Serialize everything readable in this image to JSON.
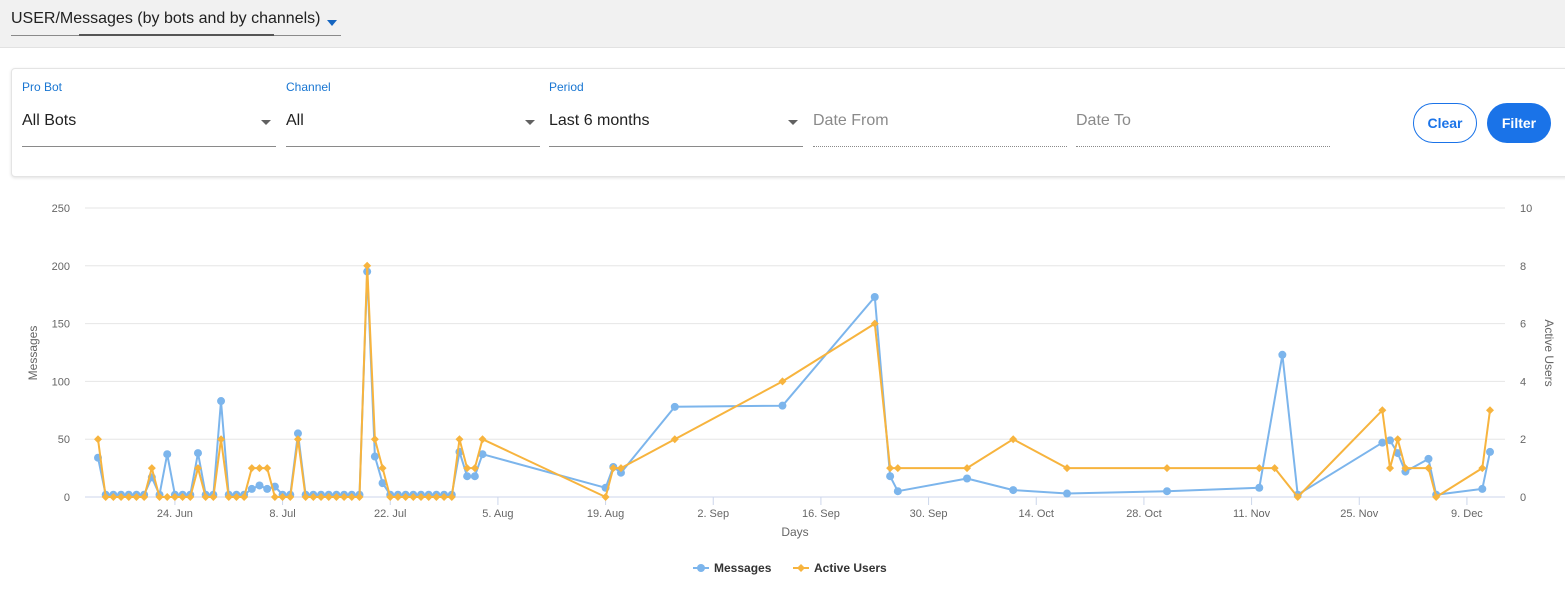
{
  "report_selector": {
    "label": "USER/Messages (by bots and by channels)"
  },
  "filters": {
    "bot": {
      "label": "Pro Bot",
      "value": "All Bots"
    },
    "channel": {
      "label": "Channel",
      "value": "All"
    },
    "period": {
      "label": "Period",
      "value": "Last 6 months"
    },
    "date_from": {
      "placeholder": "Date From"
    },
    "date_to": {
      "placeholder": "Date To"
    },
    "clear_label": "Clear",
    "filter_label": "Filter"
  },
  "colors": {
    "accent": "#1a73e8",
    "messages": "#7cb5ec",
    "active_users": "#f7b43e"
  },
  "chart_data": {
    "type": "line",
    "xlabel": "Days",
    "x_ticks": [
      "24. Jun",
      "8. Jul",
      "22. Jul",
      "5. Aug",
      "19. Aug",
      "2. Sep",
      "16. Sep",
      "30. Sep",
      "14. Oct",
      "28. Oct",
      "11. Nov",
      "25. Nov",
      "9. Dec"
    ],
    "x_tick_days": [
      10,
      24,
      38,
      52,
      66,
      80,
      94,
      108,
      122,
      136,
      150,
      164,
      178
    ],
    "y_left": {
      "label": "Messages",
      "min": 0,
      "max": 250,
      "ticks": [
        0,
        50,
        100,
        150,
        200,
        250
      ]
    },
    "y_right": {
      "label": "Active Users",
      "min": 0,
      "max": 10,
      "ticks": [
        0,
        2,
        4,
        6,
        8,
        10
      ]
    },
    "grid": true,
    "legend": "bottom-center",
    "series": [
      {
        "name": "Messages",
        "axis": "left",
        "marker": "circle",
        "points": [
          [
            0,
            34
          ],
          [
            1,
            2
          ],
          [
            2,
            2
          ],
          [
            3,
            2
          ],
          [
            4,
            2
          ],
          [
            5,
            2
          ],
          [
            6,
            2
          ],
          [
            7,
            17
          ],
          [
            8,
            2
          ],
          [
            9,
            37
          ],
          [
            10,
            2
          ],
          [
            11,
            2
          ],
          [
            12,
            2
          ],
          [
            13,
            38
          ],
          [
            14,
            2
          ],
          [
            15,
            2
          ],
          [
            16,
            83
          ],
          [
            17,
            2
          ],
          [
            18,
            2
          ],
          [
            19,
            2
          ],
          [
            20,
            7
          ],
          [
            21,
            10
          ],
          [
            22,
            7
          ],
          [
            23,
            9
          ],
          [
            24,
            2
          ],
          [
            25,
            2
          ],
          [
            26,
            55
          ],
          [
            27,
            2
          ],
          [
            28,
            2
          ],
          [
            29,
            2
          ],
          [
            30,
            2
          ],
          [
            31,
            2
          ],
          [
            32,
            2
          ],
          [
            33,
            2
          ],
          [
            34,
            2
          ],
          [
            35,
            195
          ],
          [
            36,
            35
          ],
          [
            37,
            12
          ],
          [
            38,
            2
          ],
          [
            39,
            2
          ],
          [
            40,
            2
          ],
          [
            41,
            2
          ],
          [
            42,
            2
          ],
          [
            43,
            2
          ],
          [
            44,
            2
          ],
          [
            45,
            2
          ],
          [
            46,
            2
          ],
          [
            47,
            39
          ],
          [
            48,
            18
          ],
          [
            49,
            18
          ],
          [
            50,
            37
          ],
          [
            66,
            8
          ],
          [
            67,
            26
          ],
          [
            68,
            21
          ],
          [
            75,
            78
          ],
          [
            89,
            79
          ],
          [
            101,
            173
          ],
          [
            103,
            18
          ],
          [
            104,
            5
          ],
          [
            113,
            16
          ],
          [
            119,
            6
          ],
          [
            126,
            3
          ],
          [
            139,
            5
          ],
          [
            151,
            8
          ],
          [
            154,
            123
          ],
          [
            156,
            2
          ],
          [
            167,
            47
          ],
          [
            168,
            49
          ],
          [
            169,
            38
          ],
          [
            170,
            22
          ],
          [
            173,
            33
          ],
          [
            174,
            2
          ],
          [
            180,
            7
          ],
          [
            181,
            39
          ]
        ]
      },
      {
        "name": "Active Users",
        "axis": "right",
        "marker": "diamond",
        "points": [
          [
            0,
            2
          ],
          [
            1,
            0
          ],
          [
            2,
            0
          ],
          [
            3,
            0
          ],
          [
            4,
            0
          ],
          [
            5,
            0
          ],
          [
            6,
            0
          ],
          [
            7,
            1
          ],
          [
            8,
            0
          ],
          [
            9,
            0
          ],
          [
            10,
            0
          ],
          [
            11,
            0
          ],
          [
            12,
            0
          ],
          [
            13,
            1
          ],
          [
            14,
            0
          ],
          [
            15,
            0
          ],
          [
            16,
            2
          ],
          [
            17,
            0
          ],
          [
            18,
            0
          ],
          [
            19,
            0
          ],
          [
            20,
            1
          ],
          [
            21,
            1
          ],
          [
            22,
            1
          ],
          [
            23,
            0
          ],
          [
            24,
            0
          ],
          [
            25,
            0
          ],
          [
            26,
            2
          ],
          [
            27,
            0
          ],
          [
            28,
            0
          ],
          [
            29,
            0
          ],
          [
            30,
            0
          ],
          [
            31,
            0
          ],
          [
            32,
            0
          ],
          [
            33,
            0
          ],
          [
            34,
            0
          ],
          [
            35,
            8
          ],
          [
            36,
            2
          ],
          [
            37,
            1
          ],
          [
            38,
            0
          ],
          [
            39,
            0
          ],
          [
            40,
            0
          ],
          [
            41,
            0
          ],
          [
            42,
            0
          ],
          [
            43,
            0
          ],
          [
            44,
            0
          ],
          [
            45,
            0
          ],
          [
            46,
            0
          ],
          [
            47,
            2
          ],
          [
            48,
            1
          ],
          [
            49,
            1
          ],
          [
            50,
            2
          ],
          [
            66,
            0
          ],
          [
            67,
            1
          ],
          [
            68,
            1
          ],
          [
            75,
            2
          ],
          [
            89,
            4
          ],
          [
            101,
            6
          ],
          [
            103,
            1
          ],
          [
            104,
            1
          ],
          [
            113,
            1
          ],
          [
            119,
            2
          ],
          [
            126,
            1
          ],
          [
            139,
            1
          ],
          [
            151,
            1
          ],
          [
            153,
            1
          ],
          [
            156,
            0
          ],
          [
            167,
            3
          ],
          [
            168,
            1
          ],
          [
            169,
            2
          ],
          [
            170,
            1
          ],
          [
            173,
            1
          ],
          [
            174,
            0
          ],
          [
            180,
            1
          ],
          [
            181,
            3
          ]
        ]
      }
    ]
  }
}
